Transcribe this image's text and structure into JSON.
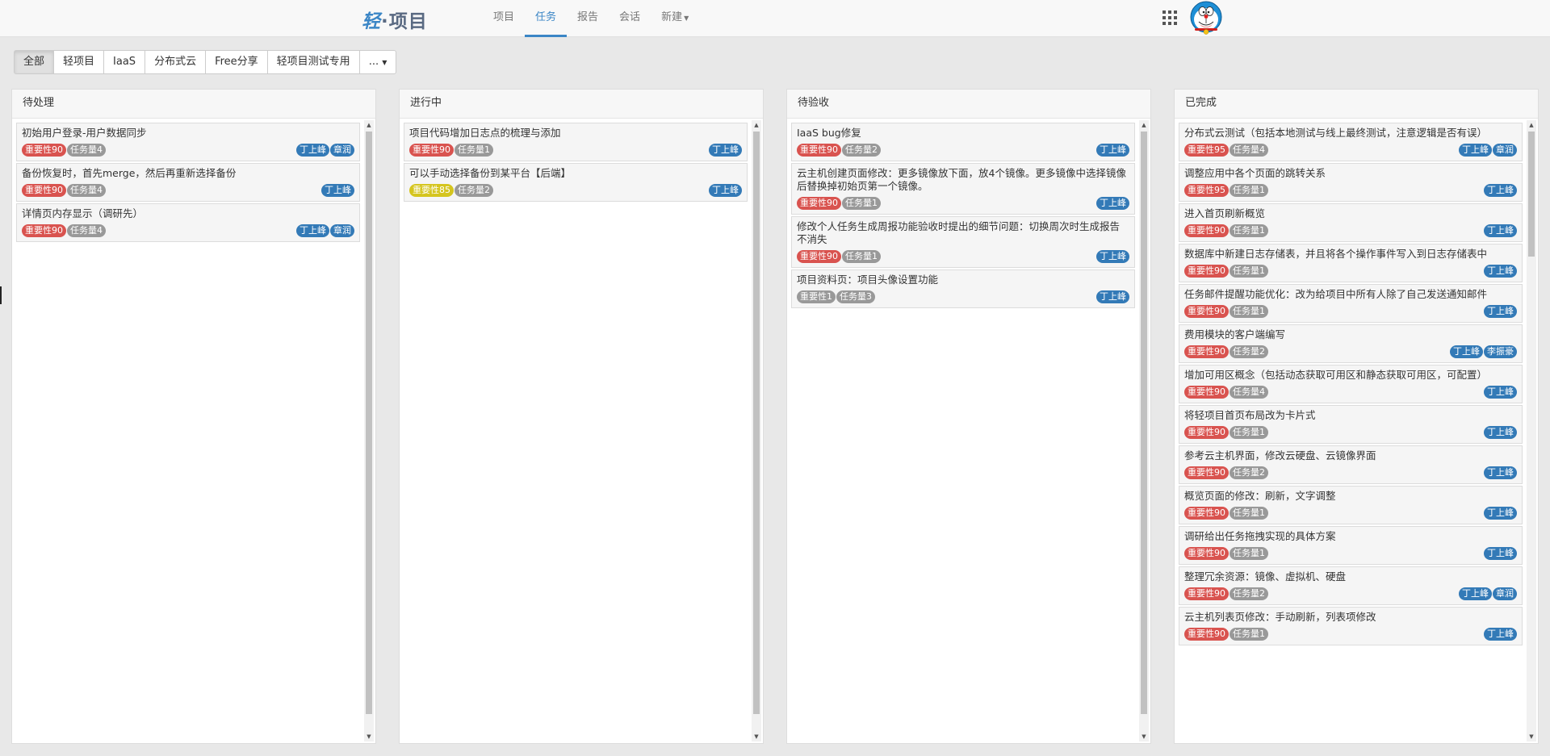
{
  "app": {
    "logo_accent": "轻",
    "logo_rest": "·项目"
  },
  "nav": {
    "items": [
      {
        "label": "项目"
      },
      {
        "label": "任务"
      },
      {
        "label": "报告"
      },
      {
        "label": "会话"
      },
      {
        "label": "新建"
      }
    ],
    "active": "任务"
  },
  "filters": {
    "items": [
      {
        "label": "全部"
      },
      {
        "label": "轻项目"
      },
      {
        "label": "IaaS"
      },
      {
        "label": "分布式云"
      },
      {
        "label": "Free分享"
      },
      {
        "label": "轻项目测试专用"
      },
      {
        "label": "..."
      }
    ],
    "active": "全部"
  },
  "columns": [
    {
      "title": "待处理",
      "cards": [
        {
          "title": "初始用户登录-用户数据同步",
          "importance": "重要性90",
          "importance_color": "red",
          "tasks": "任务量4",
          "people": [
            "丁上峰",
            "章润"
          ]
        },
        {
          "title": "备份恢复时，首先merge，然后再重新选择备份",
          "importance": "重要性90",
          "importance_color": "red",
          "tasks": "任务量4",
          "people": [
            "丁上峰"
          ]
        },
        {
          "title": "详情页内存显示（调研先）",
          "importance": "重要性90",
          "importance_color": "red",
          "tasks": "任务量4",
          "people": [
            "丁上峰",
            "章润"
          ]
        }
      ]
    },
    {
      "title": "进行中",
      "cards": [
        {
          "title": "项目代码增加日志点的梳理与添加",
          "importance": "重要性90",
          "importance_color": "red",
          "tasks": "任务量1",
          "people": [
            "丁上峰"
          ]
        },
        {
          "title": "可以手动选择备份到某平台【后端】",
          "importance": "重要性85",
          "importance_color": "yellow",
          "tasks": "任务量2",
          "people": [
            "丁上峰"
          ]
        }
      ]
    },
    {
      "title": "待验收",
      "cards": [
        {
          "title": "IaaS bug修复",
          "importance": "重要性90",
          "importance_color": "red",
          "tasks": "任务量2",
          "people": [
            "丁上峰"
          ]
        },
        {
          "title": "云主机创建页面修改：更多镜像放下面，放4个镜像。更多镜像中选择镜像后替换掉初始页第一个镜像。",
          "importance": "重要性90",
          "importance_color": "red",
          "tasks": "任务量1",
          "people": [
            "丁上峰"
          ]
        },
        {
          "title": "修改个人任务生成周报功能验收时提出的细节问题：切换周次时生成报告不消失",
          "importance": "重要性90",
          "importance_color": "red",
          "tasks": "任务量1",
          "people": [
            "丁上峰"
          ]
        },
        {
          "title": "项目资料页：项目头像设置功能",
          "importance": "重要性1",
          "importance_color": "gray",
          "tasks": "任务量3",
          "people": [
            "丁上峰"
          ]
        }
      ]
    },
    {
      "title": "已完成",
      "cards": [
        {
          "title": "分布式云测试（包括本地测试与线上最终测试，注意逻辑是否有误）",
          "importance": "重要性95",
          "importance_color": "red",
          "tasks": "任务量4",
          "people": [
            "丁上峰",
            "章润"
          ]
        },
        {
          "title": "调整应用中各个页面的跳转关系",
          "importance": "重要性95",
          "importance_color": "red",
          "tasks": "任务量1",
          "people": [
            "丁上峰"
          ]
        },
        {
          "title": "进入首页刷新概览",
          "importance": "重要性90",
          "importance_color": "red",
          "tasks": "任务量1",
          "people": [
            "丁上峰"
          ]
        },
        {
          "title": "数据库中新建日志存储表，并且将各个操作事件写入到日志存储表中",
          "importance": "重要性90",
          "importance_color": "red",
          "tasks": "任务量1",
          "people": [
            "丁上峰"
          ]
        },
        {
          "title": "任务邮件提醒功能优化：改为给项目中所有人除了自己发送通知邮件",
          "importance": "重要性90",
          "importance_color": "red",
          "tasks": "任务量1",
          "people": [
            "丁上峰"
          ]
        },
        {
          "title": "费用模块的客户端编写",
          "importance": "重要性90",
          "importance_color": "red",
          "tasks": "任务量2",
          "people": [
            "丁上峰",
            "李振豪"
          ]
        },
        {
          "title": "增加可用区概念（包括动态获取可用区和静态获取可用区，可配置）",
          "importance": "重要性90",
          "importance_color": "red",
          "tasks": "任务量4",
          "people": [
            "丁上峰"
          ]
        },
        {
          "title": "将轻项目首页布局改为卡片式",
          "importance": "重要性90",
          "importance_color": "red",
          "tasks": "任务量1",
          "people": [
            "丁上峰"
          ]
        },
        {
          "title": "参考云主机界面，修改云硬盘、云镜像界面",
          "importance": "重要性90",
          "importance_color": "red",
          "tasks": "任务量2",
          "people": [
            "丁上峰"
          ]
        },
        {
          "title": "概览页面的修改：刷新，文字调整",
          "importance": "重要性90",
          "importance_color": "red",
          "tasks": "任务量1",
          "people": [
            "丁上峰"
          ]
        },
        {
          "title": "调研给出任务拖拽实现的具体方案",
          "importance": "重要性90",
          "importance_color": "red",
          "tasks": "任务量1",
          "people": [
            "丁上峰"
          ]
        },
        {
          "title": "整理冗余资源：镜像、虚拟机、硬盘",
          "importance": "重要性90",
          "importance_color": "red",
          "tasks": "任务量2",
          "people": [
            "丁上峰",
            "章润"
          ]
        },
        {
          "title": "云主机列表页修改：手动刷新，列表项修改",
          "importance": "重要性90",
          "importance_color": "red",
          "tasks": "任务量1",
          "people": [
            "丁上峰"
          ]
        }
      ]
    }
  ],
  "colors": {
    "accent": "#3b86c6",
    "importance_red": "#d9534f",
    "importance_yellow": "#d5c51e",
    "badge_gray": "#999999",
    "person_blue": "#337ab7"
  },
  "icons": {
    "apps": "grid-apps-icon",
    "avatar": "doraemon-avatar"
  }
}
